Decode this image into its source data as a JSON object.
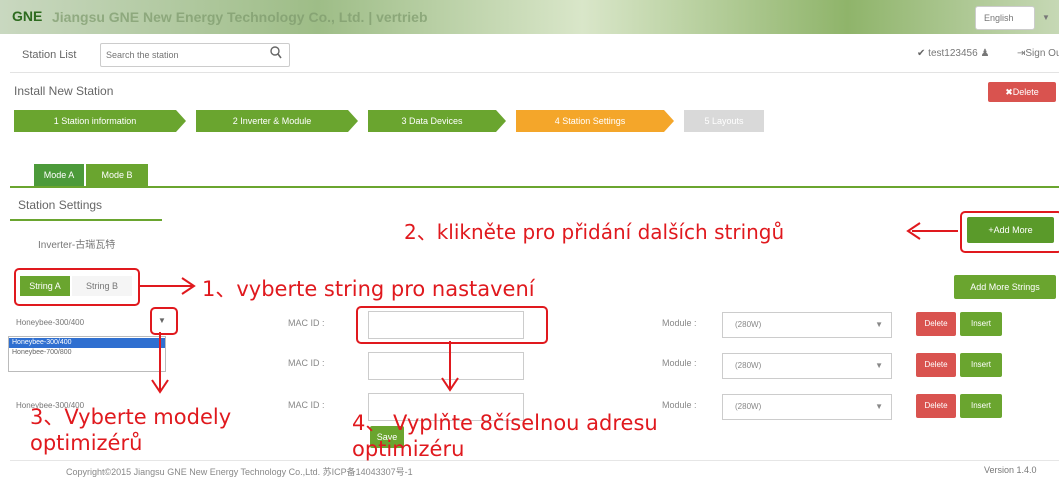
{
  "header": {
    "logo": "GNE",
    "company": "Jiangsu GNE New Energy Technology Co., Ltd. | vertrieb",
    "language": "English"
  },
  "nav": {
    "station_list": "Station List",
    "search_placeholder": "Search the station",
    "user": "test123456",
    "sign_out": "Sign Out"
  },
  "install": {
    "title": "Install New Station",
    "delete": "Delete"
  },
  "wizard": {
    "steps": [
      {
        "label": "1 Station information",
        "state": "done"
      },
      {
        "label": "2 Inverter & Module",
        "state": "done"
      },
      {
        "label": "3 Data Devices",
        "state": "done"
      },
      {
        "label": "4 Station Settings",
        "state": "active"
      },
      {
        "label": "5 Layouts",
        "state": "pending"
      }
    ]
  },
  "modes": {
    "a": "Mode A",
    "b": "Mode B"
  },
  "settings": {
    "title": "Station Settings",
    "inverter": "Inverter-古瑞瓦特",
    "add_more": "+Add More",
    "string_a": "String A",
    "string_b": "String B",
    "add_more_strings": "Add More Strings"
  },
  "rows": [
    {
      "model": "Honeybee-300/400",
      "mac_label": "MAC ID :",
      "module_label": "Module :",
      "module": "(280W)",
      "delete": "Delete",
      "insert": "Insert"
    },
    {
      "model": "Honeybee-300/400",
      "mac_label": "MAC ID :",
      "module_label": "Module :",
      "module": "(280W)",
      "delete": "Delete",
      "insert": "Insert"
    },
    {
      "model": "Honeybee-300/400",
      "mac_label": "MAC ID :",
      "module_label": "Module :",
      "module": "(280W)",
      "delete": "Delete",
      "insert": "Insert"
    }
  ],
  "dropdown_options": [
    "Honeybee-300/400",
    "Honeybee-700/800"
  ],
  "save": "Save",
  "footer": {
    "copyright": "Copyright©2015 Jiangsu GNE New Energy Technology Co.,Ltd.    苏ICP备14043307号-1",
    "version": "Version 1.4.0"
  },
  "annotations": {
    "step1": "1、vyberte string pro nastavení",
    "step2": "2、klikněte pro přidání dalších stringů",
    "step3_line1": "3、Vyberte modely",
    "step3_line2": "optimizérů",
    "step4_line1": "4、 Vyplňte 8číselnou adresu",
    "step4_line2": "optimizéru"
  },
  "colors": {
    "green": "#6aa52f",
    "orange": "#f4a62a",
    "red": "#d9534f",
    "annotation": "#e0191e"
  }
}
